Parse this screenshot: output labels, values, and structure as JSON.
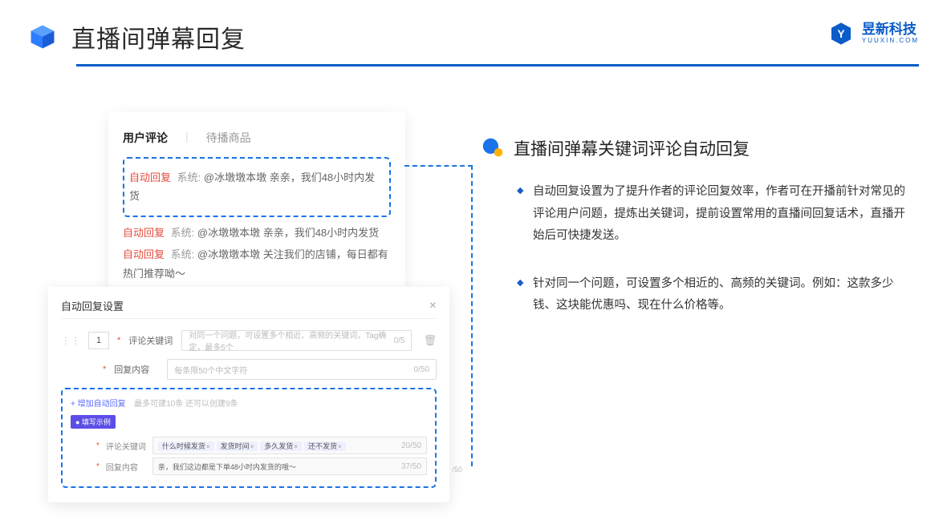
{
  "header": {
    "title": "直播间弹幕回复",
    "brand_name": "昱新科技",
    "brand_url": "YUUXIN.COM"
  },
  "comments": {
    "tab_active": "用户评论",
    "tab_inactive": "待播商品",
    "auto_tag": "自动回复",
    "sys_tag": "系统:",
    "line1": "@冰墩墩本墩 亲亲，我们48小时内发货",
    "line2": "@冰墩墩本墩 亲亲，我们48小时内发货",
    "line3": "@冰墩墩本墩 关注我们的店铺，每日都有热门推荐呦～"
  },
  "settings": {
    "title": "自动回复设置",
    "num": "1",
    "label_keyword": "评论关键词",
    "placeholder_keyword": "对同一个问题，可设置多个相近、高频的关键词，Tag确定，最多5个",
    "counter_keyword": "0/5",
    "label_content": "回复内容",
    "placeholder_content": "每条限50个中文字符",
    "counter_content": "0/50",
    "add_link": "+ 增加自动回复",
    "add_hint": "最多可建10条 还可以创建9条",
    "example_badge": "● 填写示例",
    "ex_label_kw": "评论关键词",
    "ex_tags": [
      "什么时候发货",
      "发货时间",
      "多久发货",
      "还不发货"
    ],
    "ex_kw_counter": "20/50",
    "ex_label_ct": "回复内容",
    "ex_content": "亲，我们这边都是下单48小时内发货的哦～",
    "ex_ct_counter": "37/50",
    "side_counter": "/50"
  },
  "right": {
    "section_title": "直播间弹幕关键词评论自动回复",
    "bullet1": "自动回复设置为了提升作者的评论回复效率，作者可在开播前针对常见的评论用户问题，提炼出关键词，提前设置常用的直播间回复话术，直播开始后可快捷发送。",
    "bullet2": "针对同一个问题，可设置多个相近的、高频的关键词。例如：这款多少钱、这块能优惠吗、现在什么价格等。"
  }
}
